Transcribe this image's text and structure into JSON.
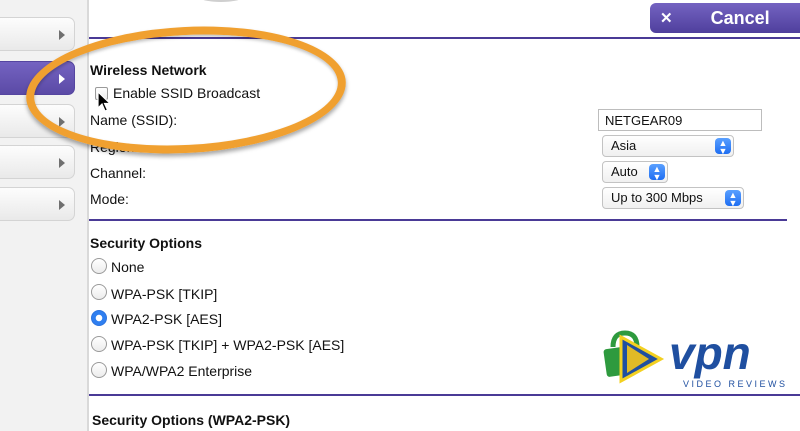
{
  "header": {
    "cancel_label": "Cancel"
  },
  "sidebar": {
    "tabs": [
      {
        "name": "sidebar-tab-1",
        "active": false
      },
      {
        "name": "sidebar-tab-2",
        "active": true
      },
      {
        "name": "sidebar-tab-3",
        "active": false
      },
      {
        "name": "sidebar-tab-4",
        "active": false
      },
      {
        "name": "sidebar-tab-5",
        "active": false
      }
    ]
  },
  "wireless": {
    "heading": "Wireless Network",
    "ssid_broadcast_label": "Enable SSID Broadcast",
    "ssid_broadcast_checked": false,
    "name_label": "Name (SSID):",
    "name_value": "NETGEAR09",
    "region_label": "Region:",
    "region_value": "Asia",
    "channel_label": "Channel:",
    "channel_value": "Auto",
    "mode_label": "Mode:",
    "mode_value": "Up to 300 Mbps"
  },
  "security": {
    "heading": "Security Options",
    "selected": "WPA2-PSK [AES]",
    "options": [
      "None",
      "WPA-PSK [TKIP]",
      "WPA2-PSK [AES]",
      "WPA-PSK [TKIP] + WPA2-PSK [AES]",
      "WPA/WPA2 Enterprise"
    ],
    "subheading": "Security Options (WPA2-PSK)"
  },
  "watermark": {
    "text": "vpn",
    "tagline": "VIDEO REVIEWS"
  },
  "colors": {
    "accent_purple": "#5b4aa6",
    "highlight_orange": "#f0a030",
    "select_blue": "#1f6ef2",
    "logo_blue": "#1f4fa0",
    "logo_green": "#2e9a3e"
  }
}
